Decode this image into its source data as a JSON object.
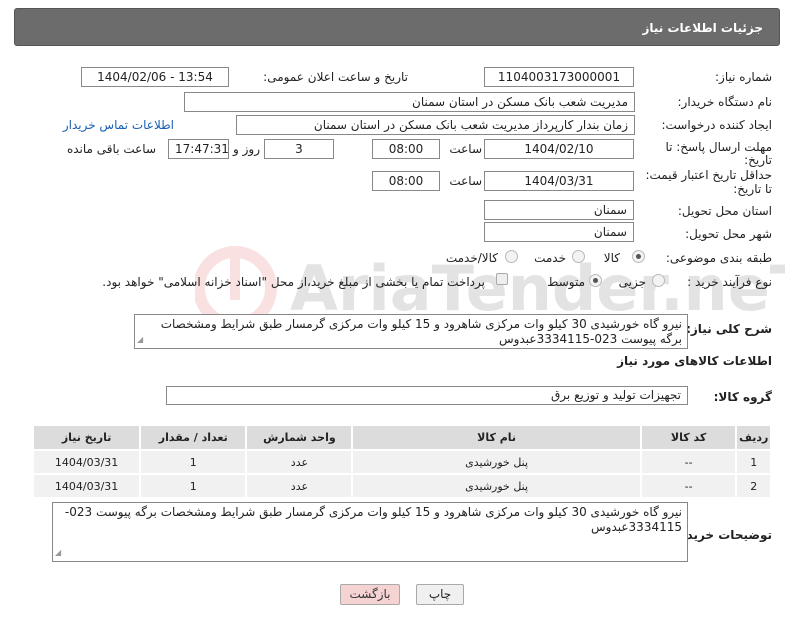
{
  "header": {
    "title": "جزئیات اطلاعات نیاز"
  },
  "fields": {
    "need_number_label": "شماره نیاز:",
    "need_number": "1104003173000001",
    "announce_label": "تاریخ و ساعت اعلان عمومی:",
    "announce_value": "1404/02/06 - 13:54",
    "buyer_org_label": "نام دستگاه خریدار:",
    "buyer_org": "مدیریت شعب بانک مسکن در استان سمنان",
    "creator_label": "ایجاد کننده درخواست:",
    "creator": "زمان بندار کارپرداز مدیریت شعب بانک مسکن در استان سمنان",
    "contact_link": "اطلاعات تماس خریدار",
    "deadline_label_1": "مهلت ارسال پاسخ: تا",
    "deadline_label_2": "تاریخ:",
    "deadline_date": "1404/02/10",
    "time_label": "ساعت",
    "deadline_time": "08:00",
    "days_value": "3",
    "days_label": "روز و",
    "remaining_time": "17:47:31",
    "remaining_label": "ساعت باقی مانده",
    "validity_label_1": "حداقل تاریخ اعتبار قیمت:",
    "validity_label_2": "تا تاریخ:",
    "validity_date": "1404/03/31",
    "validity_time": "08:00",
    "province_label": "استان محل تحویل:",
    "province": "سمنان",
    "city_label": "شهر محل تحویل:",
    "city": "سمنان",
    "category_label": "طبقه بندی موضوعی:",
    "category_options": [
      "کالا",
      "خدمت",
      "کالا/خدمت"
    ],
    "process_label": "نوع فرآیند خرید :",
    "process_options": [
      "جزیی",
      "متوسط"
    ],
    "payment_note": "پرداخت تمام یا بخشی از مبلغ خرید،از محل \"اسناد خزانه اسلامی\" خواهد بود.",
    "summary_label": "شرح کلی نیاز:",
    "summary_text": "نیرو گاه خورشیدی 30 کیلو وات مرکزی شاهرود و 15 کیلو وات مرکزی گرمسار طبق شرایط ومشخصات برگه پیوست 023-3334115عبدوس",
    "goods_info_title": "اطلاعات کالاهای مورد نیاز",
    "goods_group_label": "گروه کالا:",
    "goods_group": "تجهیزات تولید و توزیع برق",
    "buyer_notes_label": "توضیحات خریدار:",
    "buyer_notes": "نیرو گاه خورشیدی 30 کیلو وات مرکزی شاهرود و 15 کیلو وات مرکزی گرمسار طبق شرایط ومشخصات برگه پیوست 023-3334115عبدوس"
  },
  "table": {
    "headers": [
      "ردیف",
      "کد کالا",
      "نام کالا",
      "واحد شمارش",
      "تعداد / مقدار",
      "تاریخ نیاز"
    ],
    "rows": [
      [
        "1",
        "--",
        "پنل خورشیدی",
        "عدد",
        "1",
        "1404/03/31"
      ],
      [
        "2",
        "--",
        "پنل خورشیدی",
        "عدد",
        "1",
        "1404/03/31"
      ]
    ]
  },
  "buttons": {
    "print": "چاپ",
    "back": "بازگشت"
  },
  "watermark": {
    "brand": "AriaTender.neT"
  }
}
